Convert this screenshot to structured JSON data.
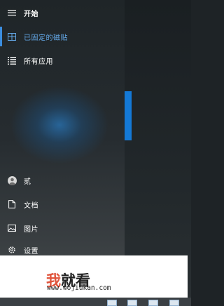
{
  "start_menu": {
    "title": "开始",
    "pinned": "已固定的磁贴",
    "all_apps": "所有应用",
    "user": "贰",
    "documents": "文档",
    "pictures": "图片",
    "settings": "设置"
  },
  "watermark": {
    "logo_part1": "我",
    "logo_part2": "就看",
    "url": "www.wojiukan.com"
  },
  "icons": [
    "hamburger-icon",
    "tiles-icon",
    "list-icon",
    "user-avatar-icon",
    "document-icon",
    "picture-icon",
    "gear-icon"
  ],
  "colors": {
    "accent": "#3b8de0",
    "pinned_text": "#63a7e6",
    "tile": "#1479d6",
    "watermark_red": "#e0533a"
  }
}
